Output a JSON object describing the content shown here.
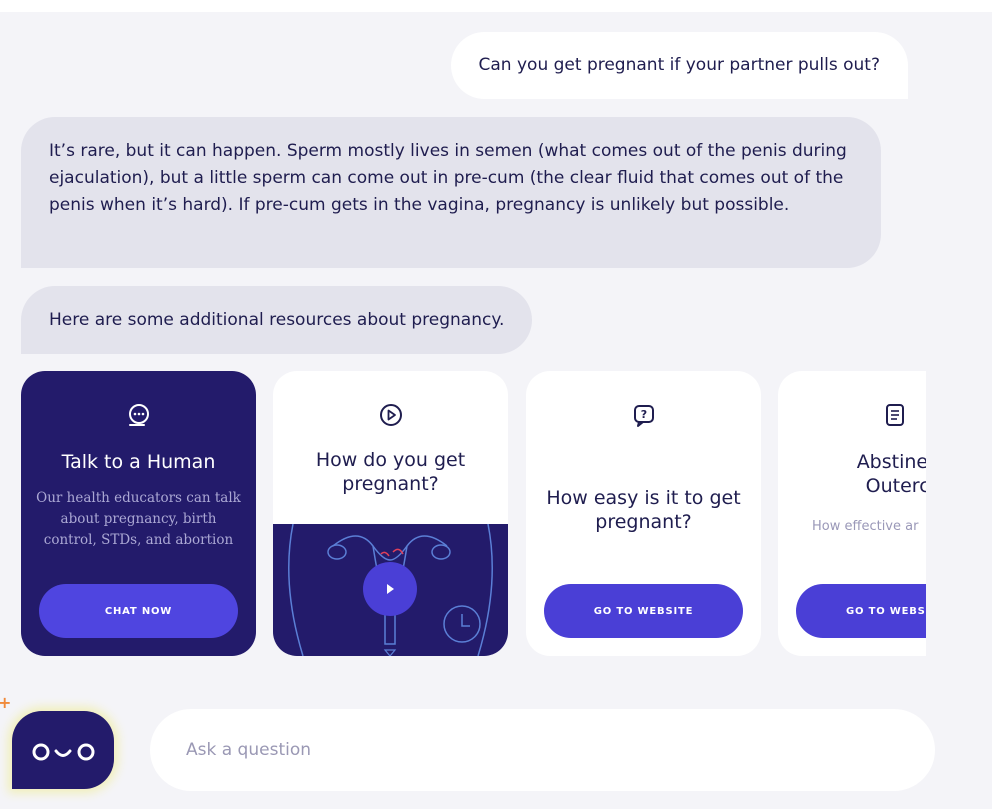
{
  "chat": {
    "user_question": "Can you get pregnant if your partner pulls out?",
    "bot_answer": "It’s rare, but it can happen. Sperm mostly lives in semen (what comes out of the penis during ejaculation), but a little sperm can come out in pre-cum (the clear fluid that comes out of the penis when it’s hard). If pre-cum gets in the vagina, pregnancy is unlikely but possible.",
    "bot_resources_intro": "Here are some additional resources about pregnancy."
  },
  "cards": {
    "human": {
      "icon": "chat-bubble-icon",
      "title": "Talk to a Human",
      "description": "Our health educators can talk about pregnancy, birth control, STDs, and abortion",
      "button": "CHAT NOW"
    },
    "video": {
      "icon": "play-circle-icon",
      "title": "How do you get pregnant?",
      "thumbnail_icons": [
        "uterus-illustration-icon",
        "play-button-icon",
        "clock-icon"
      ]
    },
    "easy": {
      "icon": "question-bubble-icon",
      "title": "How easy is it to get pregnant?",
      "button": "GO TO WEBSITE"
    },
    "abstinence": {
      "icon": "document-icon",
      "title_line1": "Abstinence",
      "title_line2": "Outercou",
      "description": "How effective ar",
      "button": "GO TO WEBS"
    }
  },
  "input": {
    "placeholder": "Ask a question",
    "value": ""
  },
  "avatar": {
    "icon": "bot-face-icon"
  },
  "colors": {
    "background": "#f4f4f8",
    "navy": "#231b6b",
    "accent": "#4a3fd6",
    "bot_bubble": "#e3e3ec",
    "text": "#1f1d4f",
    "sparkle": "#f08a3a"
  }
}
